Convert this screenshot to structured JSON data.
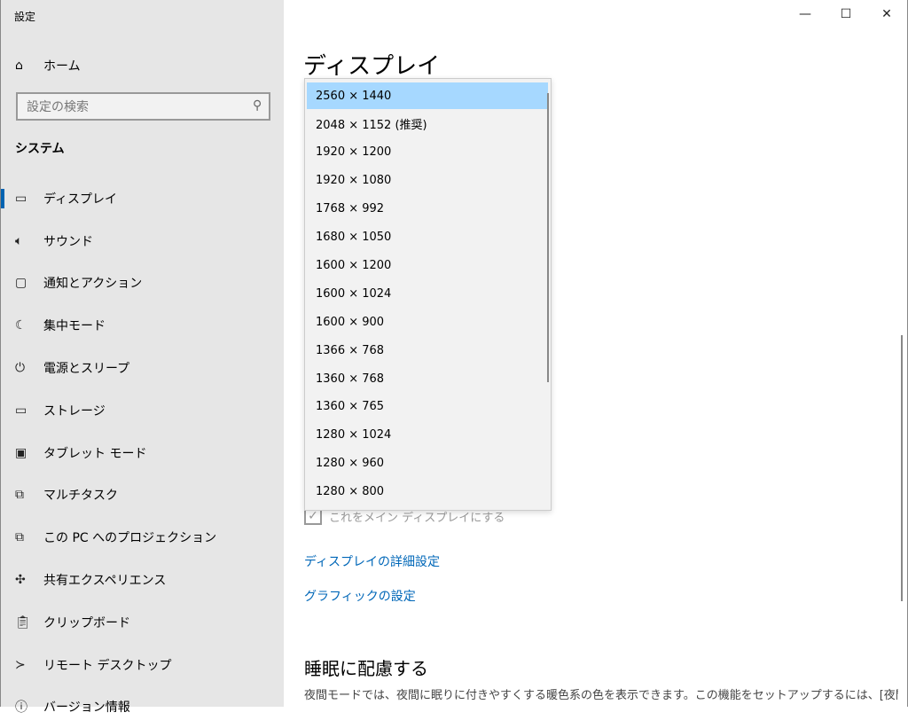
{
  "window": {
    "title": "設定",
    "minimize": "—",
    "maximize": "☐",
    "close": "✕"
  },
  "sidebar": {
    "home": {
      "icon": "home-icon",
      "label": "ホーム"
    },
    "search_placeholder": "設定の検索",
    "section": "システム",
    "items": [
      {
        "label": "ディスプレイ",
        "icon": "monitor-icon",
        "glyph": "▭",
        "active": true
      },
      {
        "label": "サウンド",
        "icon": "speaker-icon",
        "glyph": "🔈︎"
      },
      {
        "label": "通知とアクション",
        "icon": "notification-icon",
        "glyph": "▢"
      },
      {
        "label": "集中モード",
        "icon": "moon-icon",
        "glyph": "☾"
      },
      {
        "label": "電源とスリープ",
        "icon": "power-icon",
        "glyph": "⏻"
      },
      {
        "label": "ストレージ",
        "icon": "storage-icon",
        "glyph": "▭"
      },
      {
        "label": "タブレット モード",
        "icon": "tablet-icon",
        "glyph": "▣"
      },
      {
        "label": "マルチタスク",
        "icon": "multitask-icon",
        "glyph": "⧉"
      },
      {
        "label": "この PC へのプロジェクション",
        "icon": "projection-icon",
        "glyph": "⧉"
      },
      {
        "label": "共有エクスペリエンス",
        "icon": "share-icon",
        "glyph": "✣"
      },
      {
        "label": "クリップボード",
        "icon": "clipboard-icon",
        "glyph": "📋︎"
      },
      {
        "label": "リモート デスクトップ",
        "icon": "remote-desktop-icon",
        "glyph": "≻"
      },
      {
        "label": "バージョン情報",
        "icon": "info-icon",
        "glyph": "ⓘ"
      }
    ]
  },
  "main": {
    "title": "ディスプレイ",
    "resolutions": [
      "2560 × 1440",
      "2048 × 1152 (推奨)",
      "1920 × 1200",
      "1920 × 1080",
      "1768 × 992",
      "1680 × 1050",
      "1600 × 1200",
      "1600 × 1024",
      "1600 × 900",
      "1366 × 768",
      "1360 × 768",
      "1360 × 765",
      "1280 × 1024",
      "1280 × 960",
      "1280 × 800"
    ],
    "selected_resolution": "2560 × 1440",
    "main_display_checkbox": "これをメイン ディスプレイにする",
    "advanced_link": "ディスプレイの詳細設定",
    "graphics_link": "グラフィックの設定",
    "sleep_heading": "睡眠に配慮する",
    "sleep_desc": "夜間モードでは、夜間に眠りに付きやすくする暖色系の色を表示できます。この機能をセットアップするには、[夜間モード]"
  }
}
